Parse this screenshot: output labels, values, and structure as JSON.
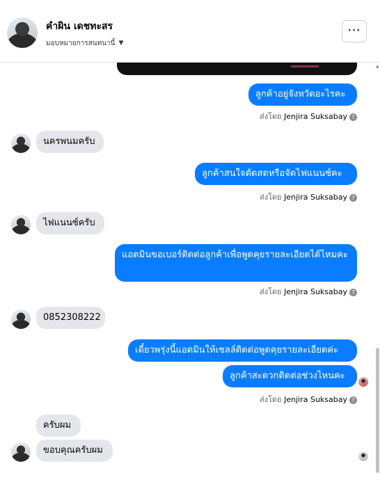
{
  "header": {
    "name": "คำผิน เดชทะสร",
    "subtitle": "มอบหมายการสนทนานี้",
    "more_label": "···"
  },
  "messages": [
    {
      "text": "ลูกค้าอยู่จังหวัดอะไรคะ"
    },
    {
      "text": "นครพนมครับ"
    },
    {
      "text": "ลูกค้าสนใจตัดสดหรือจัดไฟแนนซ์คะ"
    },
    {
      "text": "ไฟแนนซ์ครับ"
    },
    {
      "text": "แอดมินขอเบอร์ติดต่อลูกค้าเพื่อพูดคุยรายละเอียดได้ไหมคะ"
    },
    {
      "text": "0852308222"
    },
    {
      "text": "เดี๋ยวพรุ่งนี้แอดมินให้เซลล์ติดต่อพูดคุยรายละเอียดค่ะ"
    },
    {
      "text": "ลูกค้าสะดวกติดต่อช่วงไหนคะ"
    },
    {
      "text": "ครับผม"
    },
    {
      "text": "ขอบคุณครับผม"
    }
  ],
  "sent_by": {
    "prefix": "ส่งโดย",
    "agent": "Jenjira Suksabay",
    "help": "?"
  }
}
